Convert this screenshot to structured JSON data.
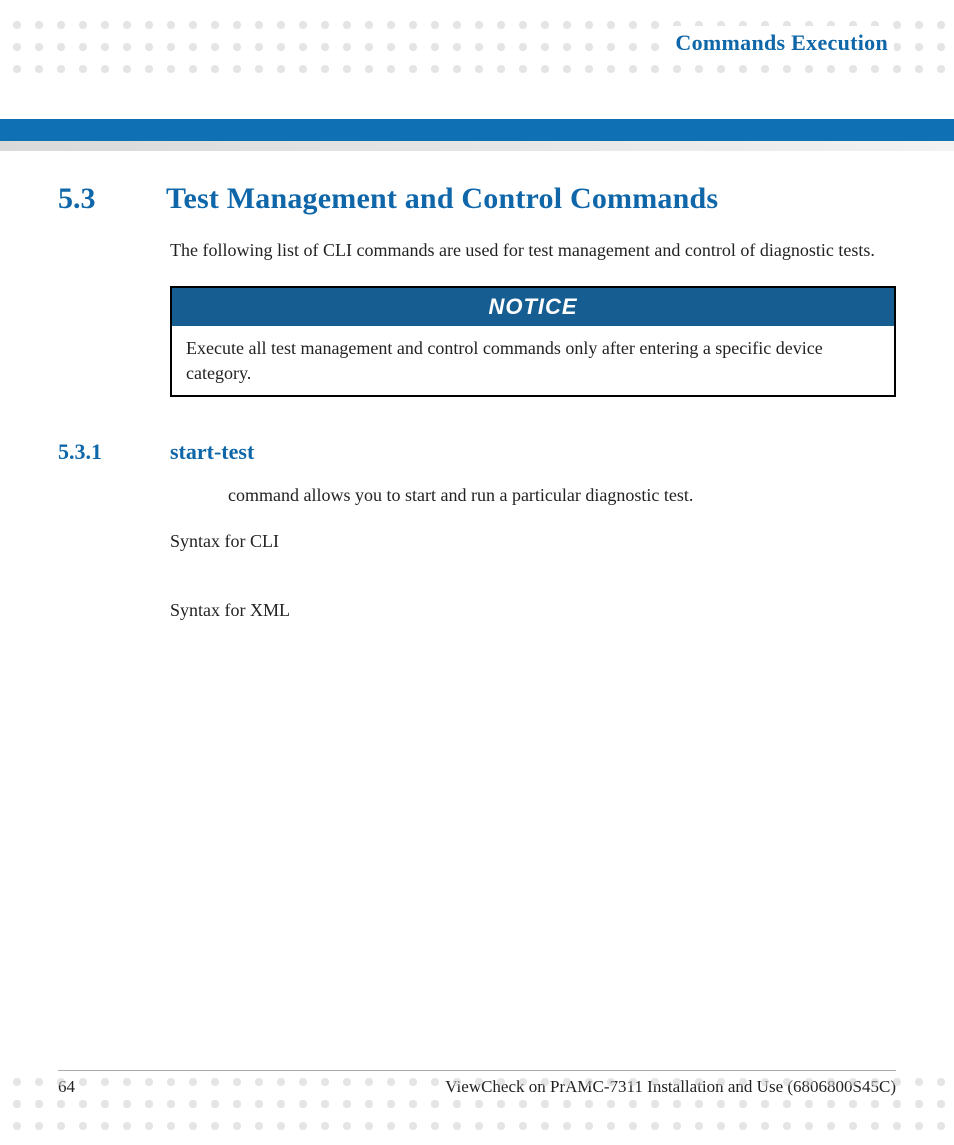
{
  "header": {
    "running_title": "Commands Execution"
  },
  "section": {
    "number": "5.3",
    "title": "Test Management and Control Commands",
    "intro": "The following list of CLI commands are used for test management and control of diagnostic tests."
  },
  "notice": {
    "label": "NOTICE",
    "text": "Execute all test management and control commands only after entering a specific device category."
  },
  "subsection": {
    "number": "5.3.1",
    "title": "start-test",
    "desc": "command allows you to start and run a particular diagnostic test.",
    "syntax_cli_label": "Syntax for CLI",
    "syntax_xml_label": "Syntax for XML"
  },
  "footer": {
    "page_number": "64",
    "doc_title": "ViewCheck on PrAMC-7311 Installation and Use (6806800S45C)"
  }
}
